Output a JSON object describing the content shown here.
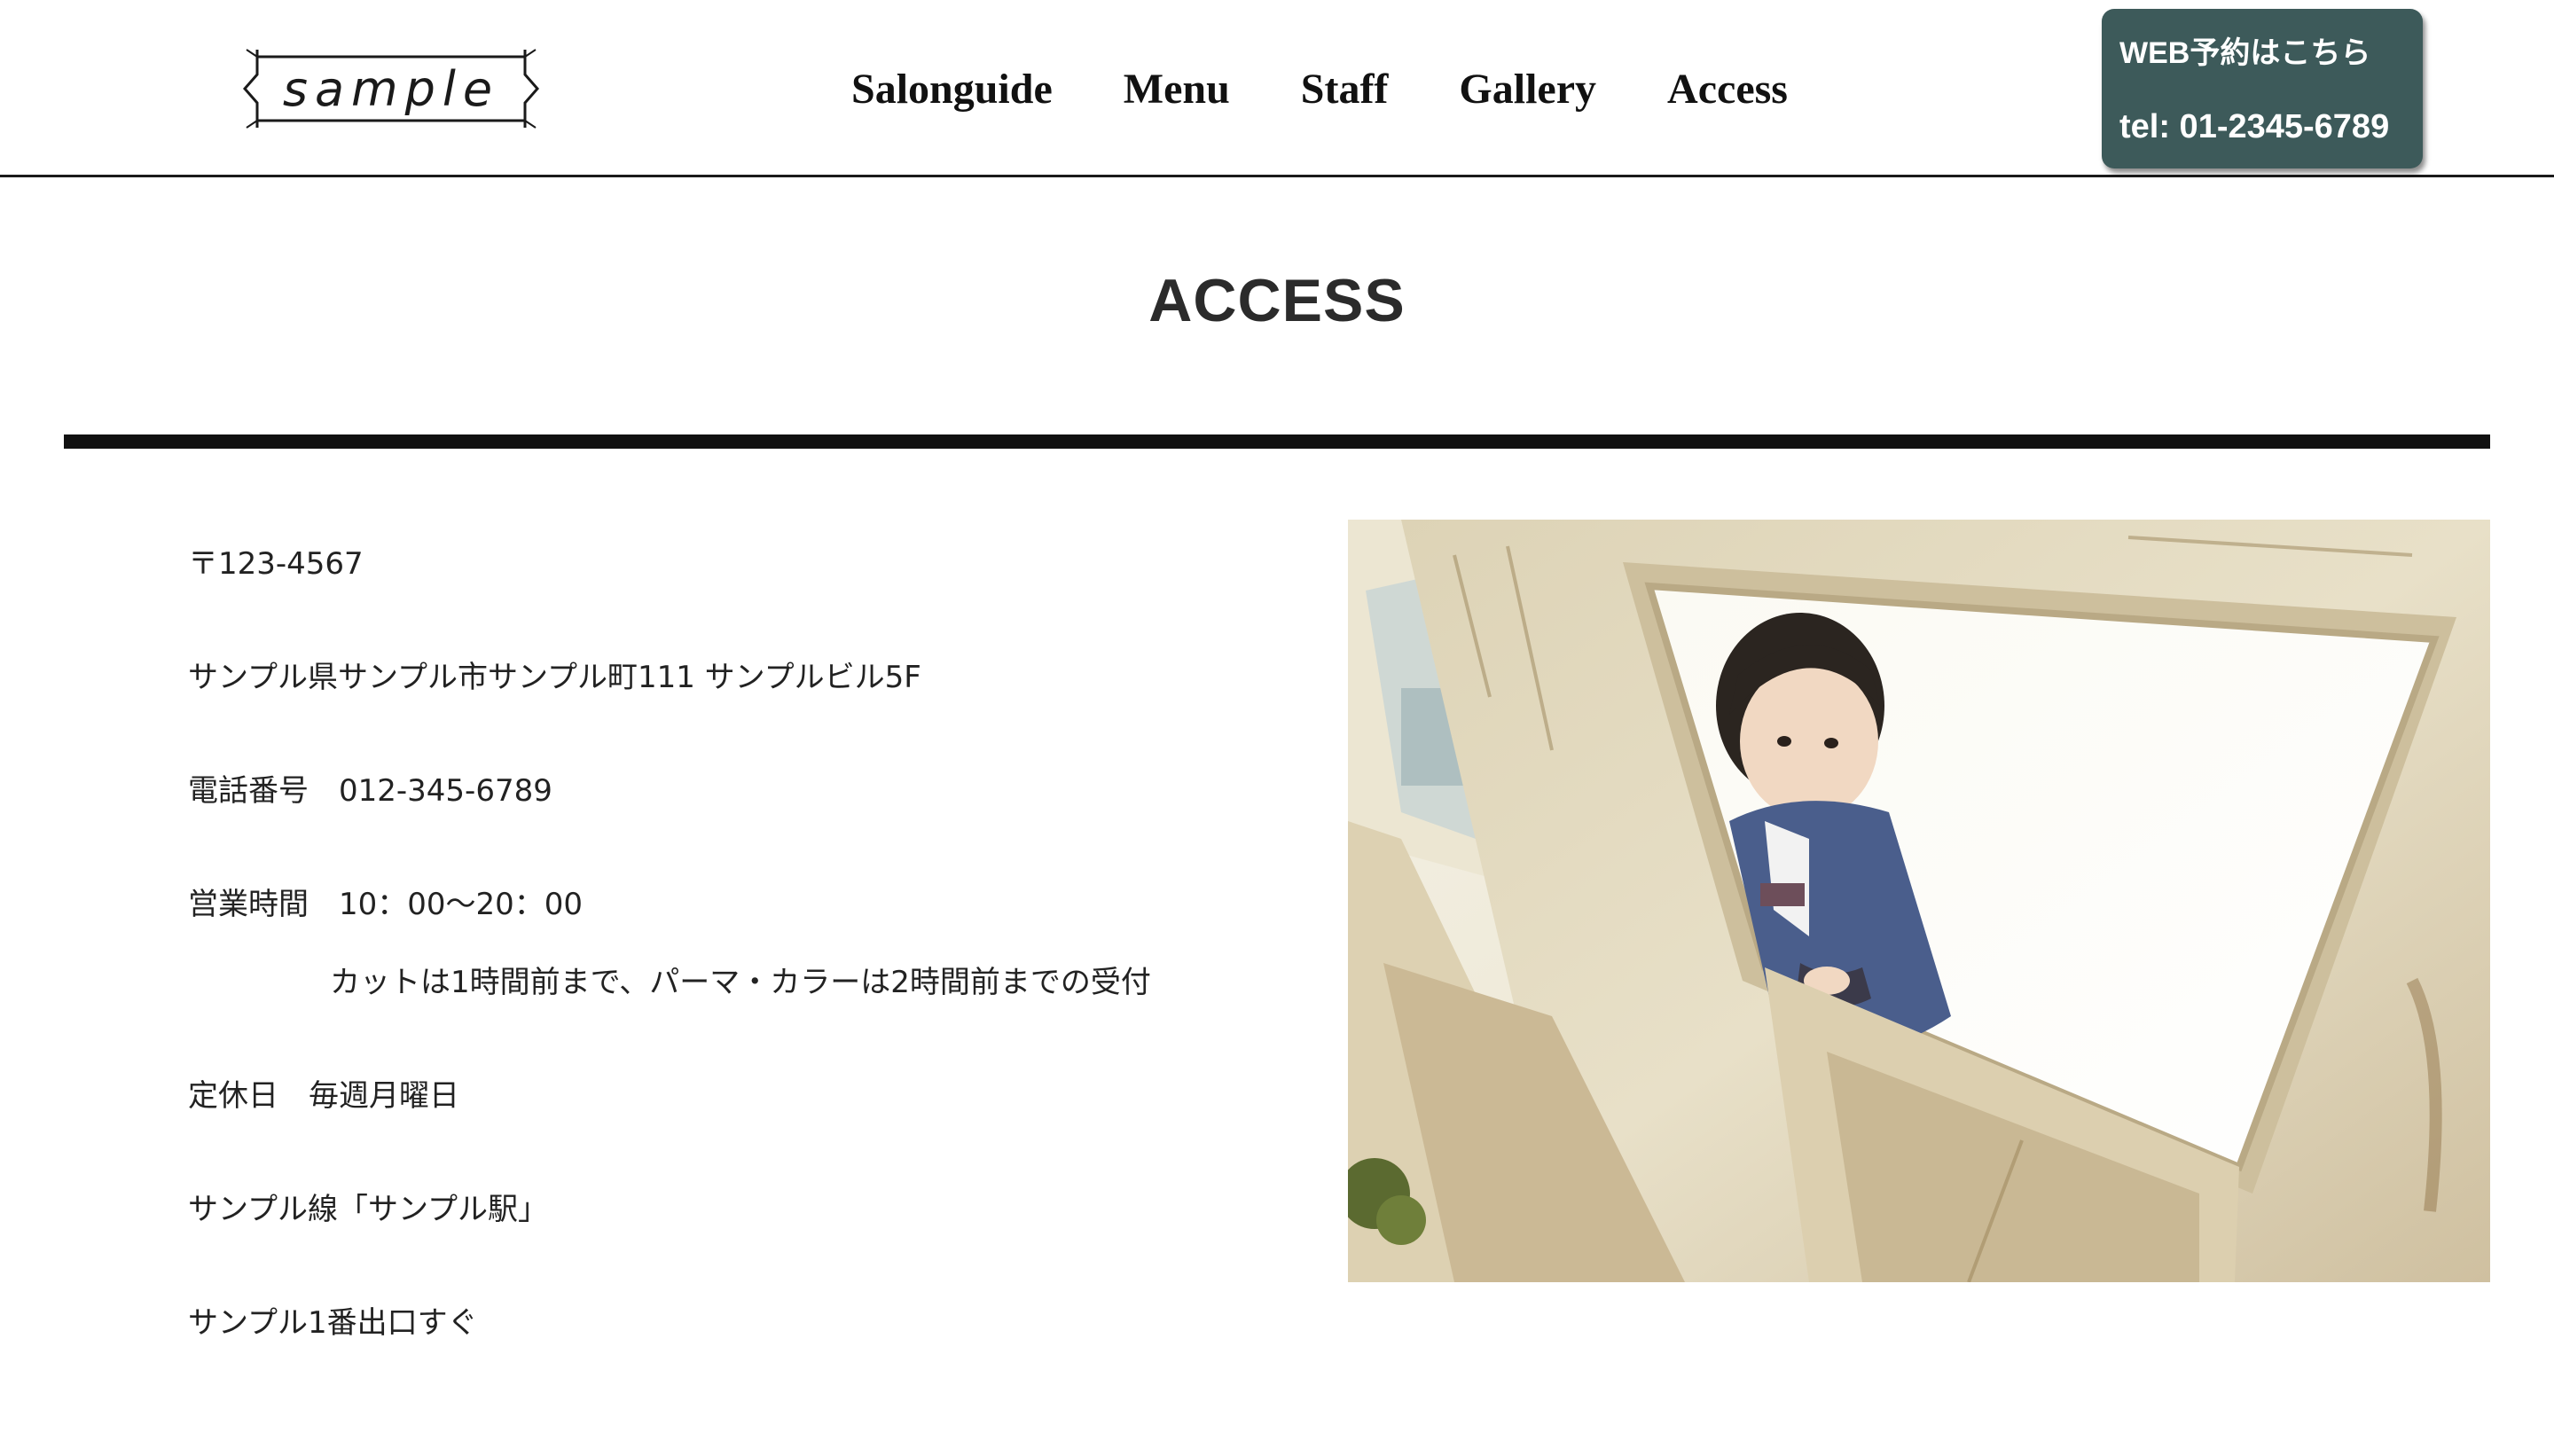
{
  "header": {
    "logo_text": "sample",
    "nav": [
      "Salonguide",
      "Menu",
      "Staff",
      "Gallery",
      "Access"
    ],
    "reserve_label": "WEB予約はこちら",
    "reserve_tel": "tel: 01-2345-6789",
    "reserve_bg_color": "#3d5a5a"
  },
  "page": {
    "title": "ACCESS"
  },
  "info": {
    "postal": "〒123-4567",
    "address": "サンプル県サンプル市サンプル町111 サンプルビル5F",
    "phone": "電話番号　012-345-6789",
    "hours": "営業時間　10：00〜20：00",
    "hours_note": "カットは1時間前まで、パーマ・カラーは2時間前までの受付",
    "closed": "定休日　毎週月曜日",
    "line": "サンプル線「サンプル駅」",
    "exit": "サンプル1番出口すぐ"
  }
}
